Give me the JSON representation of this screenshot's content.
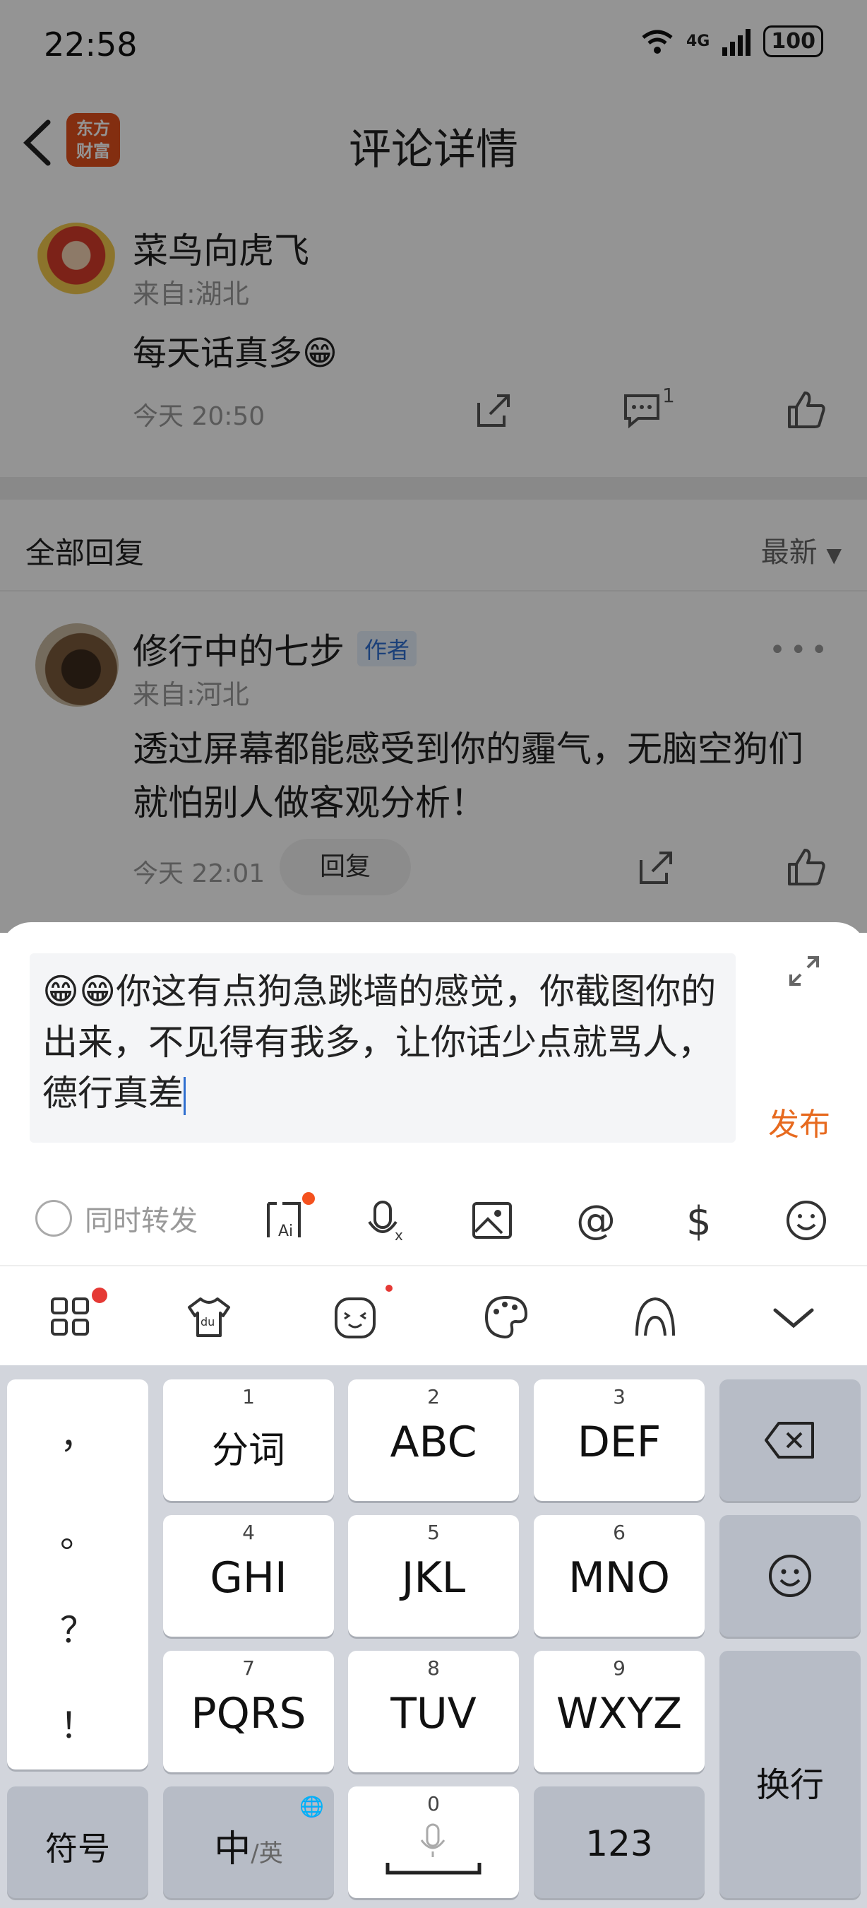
{
  "status_bar": {
    "time": "22:58",
    "network": "4G",
    "battery": "100"
  },
  "nav": {
    "title": "评论详情",
    "logo_text": "东方财富"
  },
  "comment": {
    "name": "菜鸟向虎飞",
    "location": "来自:湖北",
    "text": "每天话真多😁",
    "time": "今天 20:50",
    "reply_count": "1"
  },
  "replies": {
    "title": "全部回复",
    "sort": "最新"
  },
  "reply": {
    "name": "修行中的七步",
    "tag": "作者",
    "location": "来自:河北",
    "text": "透过屏幕都能感受到你的霾气，无脑空狗们就怕别人做客观分析！",
    "time": "今天 22:01",
    "reply_button": "回复"
  },
  "composer": {
    "text": "😁😁你这有点狗急跳墙的感觉，你截图你的出来，不见得有我多，让你话少点就骂人，德行真差",
    "publish": "发布",
    "repost_label": "同时转发",
    "tools": [
      "ai-ask-icon",
      "voice-to-text-icon",
      "image-icon",
      "at-icon",
      "dollar-icon",
      "emoji-icon"
    ]
  },
  "ime_toolbar": {
    "icons": [
      "apps-grid-icon",
      "skin-icon",
      "sticker-icon",
      "palette-icon",
      "handwriting-icon",
      "collapse-icon"
    ]
  },
  "keyboard": {
    "punct": [
      "，",
      "。",
      "？",
      "！"
    ],
    "keys": [
      {
        "num": "1",
        "label": "分词"
      },
      {
        "num": "2",
        "label": "ABC"
      },
      {
        "num": "3",
        "label": "DEF"
      },
      {
        "num": "4",
        "label": "GHI"
      },
      {
        "num": "5",
        "label": "JKL"
      },
      {
        "num": "6",
        "label": "MNO"
      },
      {
        "num": "7",
        "label": "PQRS"
      },
      {
        "num": "8",
        "label": "TUV"
      },
      {
        "num": "9",
        "label": "WXYZ"
      }
    ],
    "symbol": "符号",
    "lang_main": "中",
    "lang_alt": "/英",
    "space_num": "0",
    "num_key": "123",
    "enter": "换行"
  }
}
